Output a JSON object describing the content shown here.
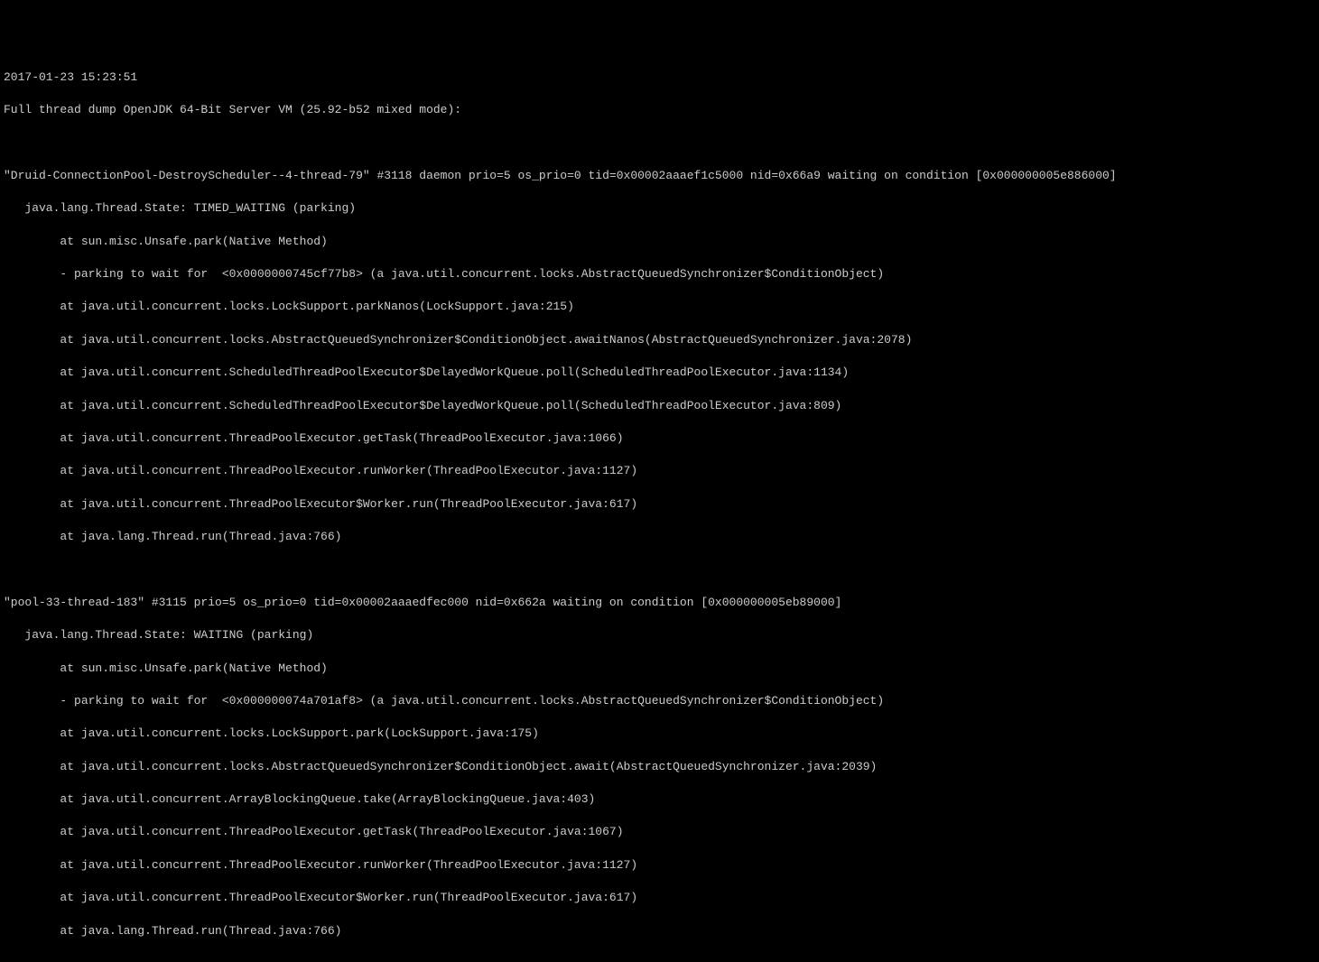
{
  "header": {
    "timestamp": "2017-01-23 15:23:51",
    "title": "Full thread dump OpenJDK 64-Bit Server VM (25.92-b52 mixed mode):"
  },
  "threads": [
    {
      "name_line": "\"Druid-ConnectionPool-DestroyScheduler--4-thread-79\" #3118 daemon prio=5 os_prio=0 tid=0x00002aaaef1c5000 nid=0x66a9 waiting on condition [0x000000005e886000]",
      "state_line": "   java.lang.Thread.State: TIMED_WAITING (parking)",
      "stack": [
        "        at sun.misc.Unsafe.park(Native Method)",
        "        - parking to wait for  <0x0000000745cf77b8> (a java.util.concurrent.locks.AbstractQueuedSynchronizer$ConditionObject)",
        "        at java.util.concurrent.locks.LockSupport.parkNanos(LockSupport.java:215)",
        "        at java.util.concurrent.locks.AbstractQueuedSynchronizer$ConditionObject.awaitNanos(AbstractQueuedSynchronizer.java:2078)",
        "        at java.util.concurrent.ScheduledThreadPoolExecutor$DelayedWorkQueue.poll(ScheduledThreadPoolExecutor.java:1134)",
        "        at java.util.concurrent.ScheduledThreadPoolExecutor$DelayedWorkQueue.poll(ScheduledThreadPoolExecutor.java:809)",
        "        at java.util.concurrent.ThreadPoolExecutor.getTask(ThreadPoolExecutor.java:1066)",
        "        at java.util.concurrent.ThreadPoolExecutor.runWorker(ThreadPoolExecutor.java:1127)",
        "        at java.util.concurrent.ThreadPoolExecutor$Worker.run(ThreadPoolExecutor.java:617)",
        "        at java.lang.Thread.run(Thread.java:766)"
      ]
    },
    {
      "name_line": "\"pool-33-thread-183\" #3115 prio=5 os_prio=0 tid=0x00002aaaedfec000 nid=0x662a waiting on condition [0x000000005eb89000]",
      "state_line": "   java.lang.Thread.State: WAITING (parking)",
      "stack": [
        "        at sun.misc.Unsafe.park(Native Method)",
        "        - parking to wait for  <0x000000074a701af8> (a java.util.concurrent.locks.AbstractQueuedSynchronizer$ConditionObject)",
        "        at java.util.concurrent.locks.LockSupport.park(LockSupport.java:175)",
        "        at java.util.concurrent.locks.AbstractQueuedSynchronizer$ConditionObject.await(AbstractQueuedSynchronizer.java:2039)",
        "        at java.util.concurrent.ArrayBlockingQueue.take(ArrayBlockingQueue.java:403)",
        "        at java.util.concurrent.ThreadPoolExecutor.getTask(ThreadPoolExecutor.java:1067)",
        "        at java.util.concurrent.ThreadPoolExecutor.runWorker(ThreadPoolExecutor.java:1127)",
        "        at java.util.concurrent.ThreadPoolExecutor$Worker.run(ThreadPoolExecutor.java:617)",
        "        at java.lang.Thread.run(Thread.java:766)"
      ]
    }
  ]
}
